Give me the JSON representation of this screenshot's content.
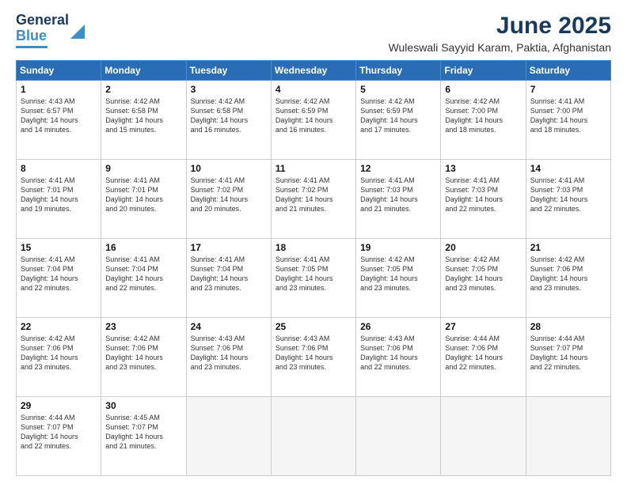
{
  "header": {
    "logo_line1": "General",
    "logo_line2": "Blue",
    "title": "June 2025",
    "subtitle": "Wuleswali Sayyid Karam, Paktia, Afghanistan"
  },
  "days_of_week": [
    "Sunday",
    "Monday",
    "Tuesday",
    "Wednesday",
    "Thursday",
    "Friday",
    "Saturday"
  ],
  "weeks": [
    [
      {
        "day": "1",
        "info": "Sunrise: 4:43 AM\nSunset: 6:57 PM\nDaylight: 14 hours\nand 14 minutes."
      },
      {
        "day": "2",
        "info": "Sunrise: 4:42 AM\nSunset: 6:58 PM\nDaylight: 14 hours\nand 15 minutes."
      },
      {
        "day": "3",
        "info": "Sunrise: 4:42 AM\nSunset: 6:58 PM\nDaylight: 14 hours\nand 16 minutes."
      },
      {
        "day": "4",
        "info": "Sunrise: 4:42 AM\nSunset: 6:59 PM\nDaylight: 14 hours\nand 16 minutes."
      },
      {
        "day": "5",
        "info": "Sunrise: 4:42 AM\nSunset: 6:59 PM\nDaylight: 14 hours\nand 17 minutes."
      },
      {
        "day": "6",
        "info": "Sunrise: 4:42 AM\nSunset: 7:00 PM\nDaylight: 14 hours\nand 18 minutes."
      },
      {
        "day": "7",
        "info": "Sunrise: 4:41 AM\nSunset: 7:00 PM\nDaylight: 14 hours\nand 18 minutes."
      }
    ],
    [
      {
        "day": "8",
        "info": "Sunrise: 4:41 AM\nSunset: 7:01 PM\nDaylight: 14 hours\nand 19 minutes."
      },
      {
        "day": "9",
        "info": "Sunrise: 4:41 AM\nSunset: 7:01 PM\nDaylight: 14 hours\nand 20 minutes."
      },
      {
        "day": "10",
        "info": "Sunrise: 4:41 AM\nSunset: 7:02 PM\nDaylight: 14 hours\nand 20 minutes."
      },
      {
        "day": "11",
        "info": "Sunrise: 4:41 AM\nSunset: 7:02 PM\nDaylight: 14 hours\nand 21 minutes."
      },
      {
        "day": "12",
        "info": "Sunrise: 4:41 AM\nSunset: 7:03 PM\nDaylight: 14 hours\nand 21 minutes."
      },
      {
        "day": "13",
        "info": "Sunrise: 4:41 AM\nSunset: 7:03 PM\nDaylight: 14 hours\nand 22 minutes."
      },
      {
        "day": "14",
        "info": "Sunrise: 4:41 AM\nSunset: 7:03 PM\nDaylight: 14 hours\nand 22 minutes."
      }
    ],
    [
      {
        "day": "15",
        "info": "Sunrise: 4:41 AM\nSunset: 7:04 PM\nDaylight: 14 hours\nand 22 minutes."
      },
      {
        "day": "16",
        "info": "Sunrise: 4:41 AM\nSunset: 7:04 PM\nDaylight: 14 hours\nand 22 minutes."
      },
      {
        "day": "17",
        "info": "Sunrise: 4:41 AM\nSunset: 7:04 PM\nDaylight: 14 hours\nand 23 minutes."
      },
      {
        "day": "18",
        "info": "Sunrise: 4:41 AM\nSunset: 7:05 PM\nDaylight: 14 hours\nand 23 minutes."
      },
      {
        "day": "19",
        "info": "Sunrise: 4:42 AM\nSunset: 7:05 PM\nDaylight: 14 hours\nand 23 minutes."
      },
      {
        "day": "20",
        "info": "Sunrise: 4:42 AM\nSunset: 7:05 PM\nDaylight: 14 hours\nand 23 minutes."
      },
      {
        "day": "21",
        "info": "Sunrise: 4:42 AM\nSunset: 7:06 PM\nDaylight: 14 hours\nand 23 minutes."
      }
    ],
    [
      {
        "day": "22",
        "info": "Sunrise: 4:42 AM\nSunset: 7:06 PM\nDaylight: 14 hours\nand 23 minutes."
      },
      {
        "day": "23",
        "info": "Sunrise: 4:42 AM\nSunset: 7:06 PM\nDaylight: 14 hours\nand 23 minutes."
      },
      {
        "day": "24",
        "info": "Sunrise: 4:43 AM\nSunset: 7:06 PM\nDaylight: 14 hours\nand 23 minutes."
      },
      {
        "day": "25",
        "info": "Sunrise: 4:43 AM\nSunset: 7:06 PM\nDaylight: 14 hours\nand 23 minutes."
      },
      {
        "day": "26",
        "info": "Sunrise: 4:43 AM\nSunset: 7:06 PM\nDaylight: 14 hours\nand 22 minutes."
      },
      {
        "day": "27",
        "info": "Sunrise: 4:44 AM\nSunset: 7:06 PM\nDaylight: 14 hours\nand 22 minutes."
      },
      {
        "day": "28",
        "info": "Sunrise: 4:44 AM\nSunset: 7:07 PM\nDaylight: 14 hours\nand 22 minutes."
      }
    ],
    [
      {
        "day": "29",
        "info": "Sunrise: 4:44 AM\nSunset: 7:07 PM\nDaylight: 14 hours\nand 22 minutes."
      },
      {
        "day": "30",
        "info": "Sunrise: 4:45 AM\nSunset: 7:07 PM\nDaylight: 14 hours\nand 21 minutes."
      },
      {
        "day": "",
        "info": ""
      },
      {
        "day": "",
        "info": ""
      },
      {
        "day": "",
        "info": ""
      },
      {
        "day": "",
        "info": ""
      },
      {
        "day": "",
        "info": ""
      }
    ]
  ]
}
